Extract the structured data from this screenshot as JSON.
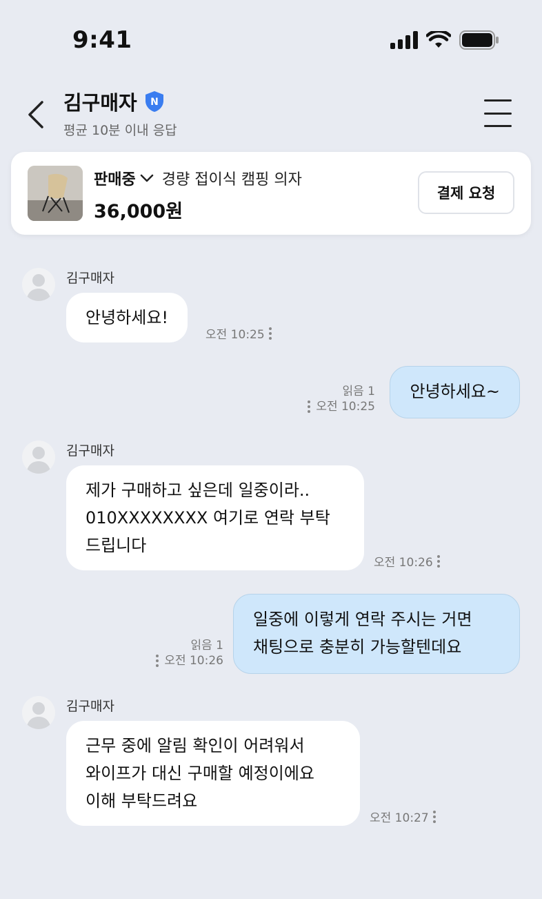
{
  "status_bar": {
    "time": "9:41"
  },
  "header": {
    "title": "김구매자",
    "subtitle": "평균 10분 이내 응답",
    "badge": "N"
  },
  "product": {
    "status": "판매중",
    "name": "경량 접이식 캠핑 의자",
    "price": "36,000원",
    "pay_button": "결제 요청"
  },
  "messages": [
    {
      "dir": "in",
      "sender": "김구매자",
      "lines": [
        "안녕하세요!"
      ],
      "time": "오전 10:25"
    },
    {
      "dir": "out",
      "read": "읽음 1",
      "lines": [
        "안녕하세요~"
      ],
      "time": "오전 10:25"
    },
    {
      "dir": "in",
      "sender": "김구매자",
      "lines": [
        "제가 구매하고 싶은데 일중이라..",
        "010XXXXXXXX 여기로 연락 부탁",
        "드립니다"
      ],
      "time": "오전 10:26"
    },
    {
      "dir": "out",
      "read": "읽음 1",
      "lines": [
        "일중에 이렇게 연락 주시는 거면",
        "채팅으로 충분히 가능할텐데요"
      ],
      "time": "오전 10:26"
    },
    {
      "dir": "in",
      "sender": "김구매자",
      "lines": [
        "근무 중에 알림 확인이 어려워서",
        "와이프가 대신 구매할 예정이에요",
        "이해 부탁드려요"
      ],
      "time": "오전 10:27"
    }
  ],
  "colors": {
    "background": "#e8ebf2",
    "outgoing_bubble": "#cfe7fb",
    "badge": "#3a7df0"
  }
}
